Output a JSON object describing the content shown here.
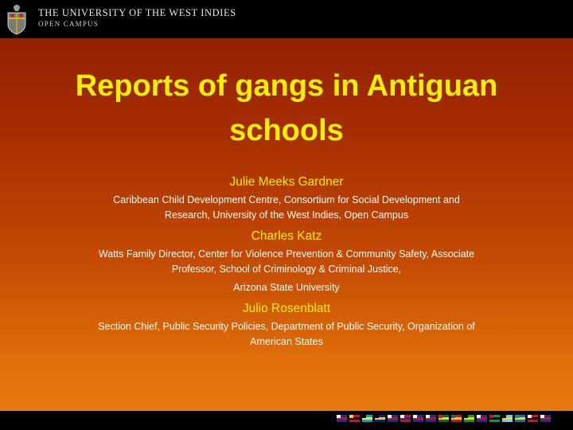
{
  "header": {
    "university": "THE UNIVERSITY OF THE WEST INDIES",
    "campus": "OPEN CAMPUS"
  },
  "title": {
    "line1": "Reports of gangs in Antiguan",
    "line2": "schools"
  },
  "authors": [
    {
      "name": "Julie Meeks Gardner",
      "affiliation": [
        "Caribbean Child Development Centre, Consortium for Social Development and",
        "Research, University of the West Indies, Open Campus"
      ]
    },
    {
      "name": "Charles Katz",
      "affiliation": [
        "Watts Family Director, Center for Violence Prevention & Community Safety, Associate",
        "Professor, School of Criminology & Criminal Justice,",
        "Arizona State University"
      ]
    },
    {
      "name": "Julio Rosenblatt",
      "affiliation": [
        "Section Chief, Public Security  Policies, Department of Public Security, Organization of",
        "American States"
      ]
    }
  ],
  "footer": {
    "flags": [
      {
        "icon": "flag-anguilla-icon",
        "colors": [
          "#1b2f8f",
          "#c8102e",
          "#ffffff"
        ]
      },
      {
        "icon": "flag-antigua-icon",
        "colors": [
          "#ce1126",
          "#000000",
          "#fcd116"
        ]
      },
      {
        "icon": "flag-bahamas-icon",
        "colors": [
          "#00abc9",
          "#fae042",
          "#000000"
        ]
      },
      {
        "icon": "flag-barbados-icon",
        "colors": [
          "#00267f",
          "#ffc726",
          "#000000"
        ]
      },
      {
        "icon": "flag-belize-icon",
        "colors": [
          "#003f87",
          "#ce1126",
          "#ffffff"
        ]
      },
      {
        "icon": "flag-bermuda-icon",
        "colors": [
          "#c8102e",
          "#1b2f8f",
          "#ffffff"
        ]
      },
      {
        "icon": "flag-bvi-icon",
        "colors": [
          "#1b2f8f",
          "#c8102e",
          "#ffffff"
        ]
      },
      {
        "icon": "flag-cayman-icon",
        "colors": [
          "#1b2f8f",
          "#c8102e",
          "#ffffff"
        ]
      },
      {
        "icon": "flag-dominica-icon",
        "colors": [
          "#006b3f",
          "#fcd116",
          "#d41c30"
        ]
      },
      {
        "icon": "flag-grenada-icon",
        "colors": [
          "#ce1126",
          "#fcd116",
          "#007a5e"
        ]
      },
      {
        "icon": "flag-jamaica-icon",
        "colors": [
          "#009b3a",
          "#fed100",
          "#000000"
        ]
      },
      {
        "icon": "flag-montserrat-icon",
        "colors": [
          "#1b2f8f",
          "#c8102e",
          "#ffffff"
        ]
      },
      {
        "icon": "flag-stkitts-icon",
        "colors": [
          "#009e49",
          "#000000",
          "#ce1126"
        ]
      },
      {
        "icon": "flag-stlucia-icon",
        "colors": [
          "#66ccff",
          "#fcd116",
          "#000000"
        ]
      },
      {
        "icon": "flag-stvincent-icon",
        "colors": [
          "#0072c6",
          "#fcd116",
          "#009e60"
        ]
      },
      {
        "icon": "flag-trinidad-icon",
        "colors": [
          "#ce1126",
          "#000000",
          "#ffffff"
        ]
      },
      {
        "icon": "flag-turks-icon",
        "colors": [
          "#1b2f8f",
          "#c8102e",
          "#ffffff"
        ]
      }
    ]
  },
  "colors": {
    "title": "#f4f000",
    "author_name": "#f4f000",
    "affiliation": "#ffffff",
    "bar": "#000000"
  }
}
